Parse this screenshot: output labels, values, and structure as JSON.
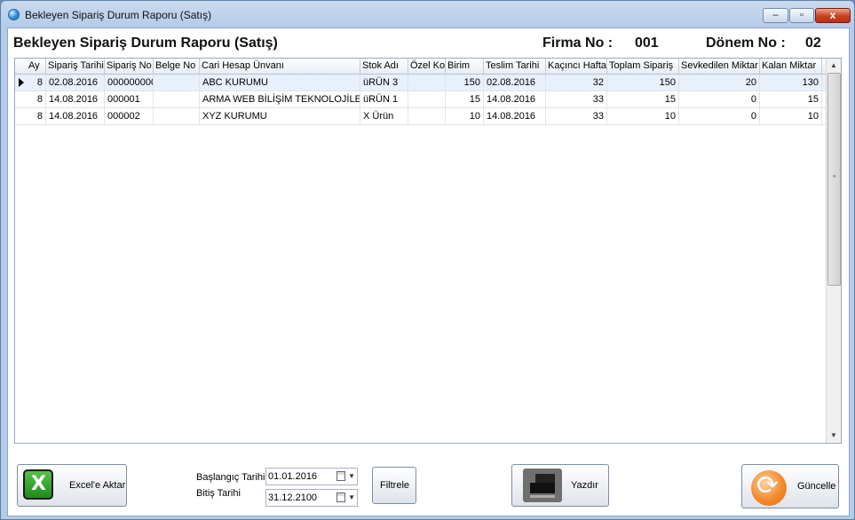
{
  "window": {
    "title": "Bekleyen Sipariş Durum Raporu (Satış)",
    "close_glyph": "x",
    "min_glyph": "–",
    "max_glyph": "▫"
  },
  "header": {
    "title": "Bekleyen Sipariş Durum Raporu (Satış)",
    "firma_label": "Firma No :",
    "firma_value": "001",
    "donem_label": "Dönem No :",
    "donem_value": "02"
  },
  "grid": {
    "columns": [
      "Ay",
      "Sipariş Tarihi",
      "Sipariş No",
      "Belge No",
      "Cari Hesap Ünvanı",
      "Stok Adı",
      "Özel Kod",
      "Birim",
      "Teslim Tarihi",
      "Kaçıncı Hafta",
      "Toplam Sipariş",
      "Sevkedilen Miktar",
      "Kalan Miktar"
    ],
    "rows": [
      [
        "8",
        "02.08.2016",
        "000000000",
        "",
        "ABC KURUMU",
        "üRÜN 3",
        "",
        "150",
        "02.08.2016",
        "32",
        "150",
        "20",
        "130"
      ],
      [
        "8",
        "14.08.2016",
        "000001",
        "",
        "ARMA WEB BİLİŞİM TEKNOLOJİLERİ",
        "üRÜN 1",
        "",
        "15",
        "14.08.2016",
        "33",
        "15",
        "0",
        "15"
      ],
      [
        "8",
        "14.08.2016",
        "000002",
        "",
        "XYZ KURUMU",
        "X Ürün",
        "",
        "10",
        "14.08.2016",
        "33",
        "10",
        "0",
        "10"
      ]
    ],
    "selected_row": 0
  },
  "footer": {
    "excel_label": "Excel'e Aktar",
    "start_label": "Başlangıç Tarihi",
    "start_value": "01.01.2016",
    "end_label": "Bitiş Tarihi",
    "end_value": "31.12.2100",
    "filter_label": "Filtrele",
    "print_label": "Yazdır",
    "refresh_label": "Güncelle"
  },
  "icons": {
    "app": "globe-icon",
    "excel": "excel-icon",
    "print": "printer-icon",
    "refresh": "refresh-icon",
    "calendar": "calendar-icon"
  }
}
